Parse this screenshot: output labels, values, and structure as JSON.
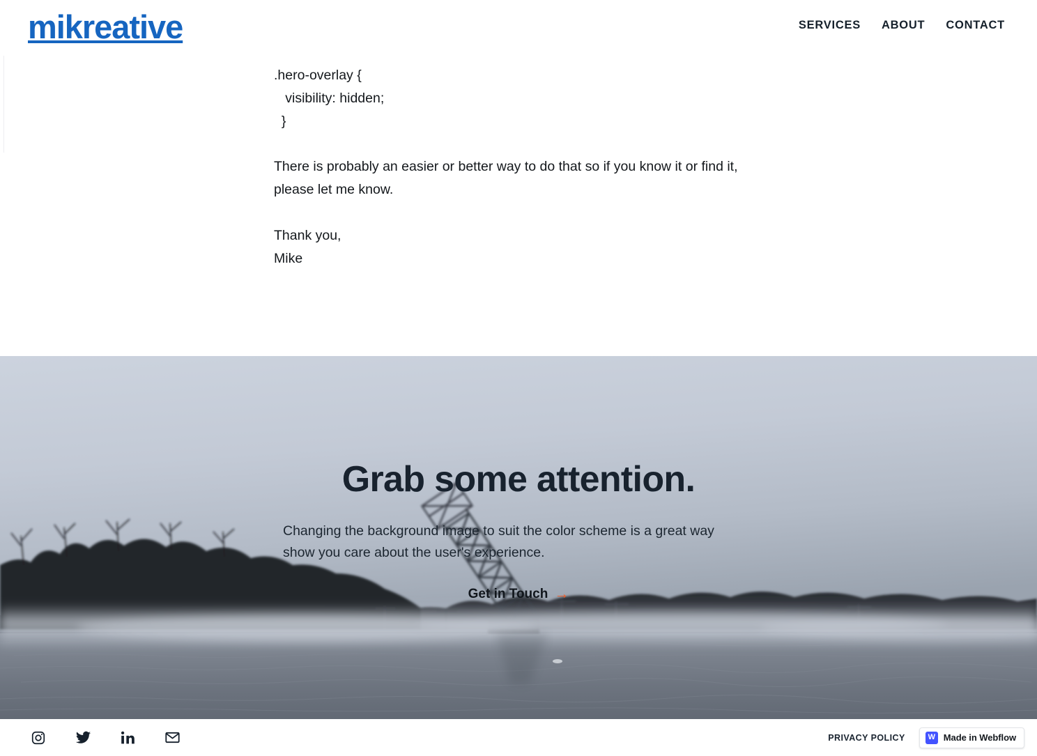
{
  "header": {
    "logo_text": "mikreative",
    "logo_color": "#1665c0",
    "nav_items": [
      {
        "label": "SERVICES",
        "name": "nav-link-services"
      },
      {
        "label": "ABOUT",
        "name": "nav-link-about"
      },
      {
        "label": "CONTACT",
        "name": "nav-link-contact"
      }
    ]
  },
  "article": {
    "code_snippet": ".hero-overlay {\n   visibility: hidden;\n  }",
    "paragraph": "There is probably an easier or better way to do that so if you know it or find it, please let me know.",
    "sign_off": "Thank you,",
    "signature_name": "Mike"
  },
  "hero": {
    "title": "Grab some attention.",
    "subtitle": "Changing the background image to suit the color scheme is a great way show you care about the user's experience.",
    "cta_label": "Get in Touch",
    "cta_arrow": "→",
    "cta_arrow_color": "#f25c26",
    "image_description": "Misty river at dawn with a raised lift bridge and bare tree line",
    "title_color": "#18222e"
  },
  "footer": {
    "social": [
      {
        "label": "Instagram",
        "name": "instagram-icon"
      },
      {
        "label": "Twitter",
        "name": "twitter-icon"
      },
      {
        "label": "LinkedIn",
        "name": "linkedin-icon"
      },
      {
        "label": "Email",
        "name": "email-icon"
      }
    ],
    "privacy_label": "PRIVACY POLICY",
    "badge_mark": "W",
    "badge_label": "Made in Webflow",
    "badge_mark_color": "#4353ff"
  }
}
